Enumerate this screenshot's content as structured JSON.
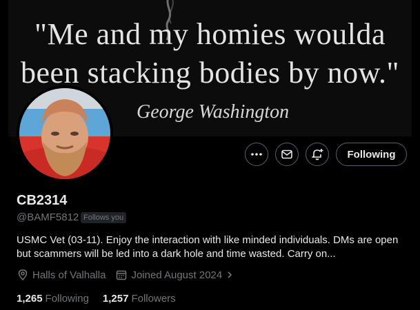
{
  "banner": {
    "quote_line1": "\"Me and my homies woulda",
    "quote_line2": "been stacking bodies by now.\"",
    "attribution": "George Washington"
  },
  "actions": {
    "more_icon": "more-icon",
    "message_icon": "mail-icon",
    "notify_icon": "bell-plus-icon",
    "follow_label": "Following"
  },
  "profile": {
    "display_name": "CB2314",
    "handle": "@BAMF5812",
    "follows_you": "Follows you",
    "bio": "USMC Vet (03-11). Enjoy the interaction with like minded individuals. DMs are open but scammers will be led into a dark hole and time wasted. Carry on...",
    "location": "Halls of Valhalla",
    "joined": "Joined August 2024",
    "following_count": "1,265",
    "following_label": "Following",
    "followers_count": "1,257",
    "followers_label": "Followers"
  },
  "colors": {
    "background": "#000000",
    "text_primary": "#e7e9ea",
    "text_secondary": "#71767b",
    "border": "#536471"
  }
}
